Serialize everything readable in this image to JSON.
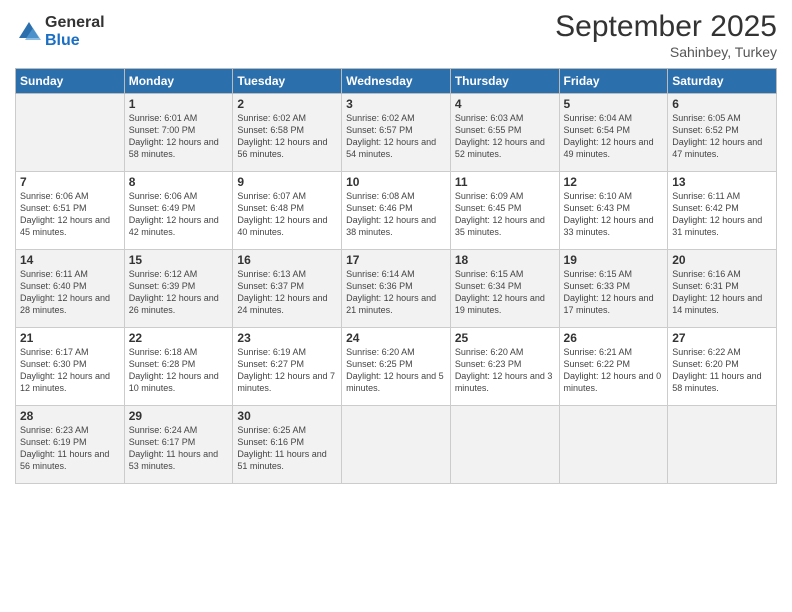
{
  "logo": {
    "general": "General",
    "blue": "Blue"
  },
  "title": "September 2025",
  "subtitle": "Sahinbey, Turkey",
  "weekdays": [
    "Sunday",
    "Monday",
    "Tuesday",
    "Wednesday",
    "Thursday",
    "Friday",
    "Saturday"
  ],
  "weeks": [
    [
      {
        "day": "",
        "sunrise": "",
        "sunset": "",
        "daylight": ""
      },
      {
        "day": "1",
        "sunrise": "Sunrise: 6:01 AM",
        "sunset": "Sunset: 7:00 PM",
        "daylight": "Daylight: 12 hours and 58 minutes."
      },
      {
        "day": "2",
        "sunrise": "Sunrise: 6:02 AM",
        "sunset": "Sunset: 6:58 PM",
        "daylight": "Daylight: 12 hours and 56 minutes."
      },
      {
        "day": "3",
        "sunrise": "Sunrise: 6:02 AM",
        "sunset": "Sunset: 6:57 PM",
        "daylight": "Daylight: 12 hours and 54 minutes."
      },
      {
        "day": "4",
        "sunrise": "Sunrise: 6:03 AM",
        "sunset": "Sunset: 6:55 PM",
        "daylight": "Daylight: 12 hours and 52 minutes."
      },
      {
        "day": "5",
        "sunrise": "Sunrise: 6:04 AM",
        "sunset": "Sunset: 6:54 PM",
        "daylight": "Daylight: 12 hours and 49 minutes."
      },
      {
        "day": "6",
        "sunrise": "Sunrise: 6:05 AM",
        "sunset": "Sunset: 6:52 PM",
        "daylight": "Daylight: 12 hours and 47 minutes."
      }
    ],
    [
      {
        "day": "7",
        "sunrise": "Sunrise: 6:06 AM",
        "sunset": "Sunset: 6:51 PM",
        "daylight": "Daylight: 12 hours and 45 minutes."
      },
      {
        "day": "8",
        "sunrise": "Sunrise: 6:06 AM",
        "sunset": "Sunset: 6:49 PM",
        "daylight": "Daylight: 12 hours and 42 minutes."
      },
      {
        "day": "9",
        "sunrise": "Sunrise: 6:07 AM",
        "sunset": "Sunset: 6:48 PM",
        "daylight": "Daylight: 12 hours and 40 minutes."
      },
      {
        "day": "10",
        "sunrise": "Sunrise: 6:08 AM",
        "sunset": "Sunset: 6:46 PM",
        "daylight": "Daylight: 12 hours and 38 minutes."
      },
      {
        "day": "11",
        "sunrise": "Sunrise: 6:09 AM",
        "sunset": "Sunset: 6:45 PM",
        "daylight": "Daylight: 12 hours and 35 minutes."
      },
      {
        "day": "12",
        "sunrise": "Sunrise: 6:10 AM",
        "sunset": "Sunset: 6:43 PM",
        "daylight": "Daylight: 12 hours and 33 minutes."
      },
      {
        "day": "13",
        "sunrise": "Sunrise: 6:11 AM",
        "sunset": "Sunset: 6:42 PM",
        "daylight": "Daylight: 12 hours and 31 minutes."
      }
    ],
    [
      {
        "day": "14",
        "sunrise": "Sunrise: 6:11 AM",
        "sunset": "Sunset: 6:40 PM",
        "daylight": "Daylight: 12 hours and 28 minutes."
      },
      {
        "day": "15",
        "sunrise": "Sunrise: 6:12 AM",
        "sunset": "Sunset: 6:39 PM",
        "daylight": "Daylight: 12 hours and 26 minutes."
      },
      {
        "day": "16",
        "sunrise": "Sunrise: 6:13 AM",
        "sunset": "Sunset: 6:37 PM",
        "daylight": "Daylight: 12 hours and 24 minutes."
      },
      {
        "day": "17",
        "sunrise": "Sunrise: 6:14 AM",
        "sunset": "Sunset: 6:36 PM",
        "daylight": "Daylight: 12 hours and 21 minutes."
      },
      {
        "day": "18",
        "sunrise": "Sunrise: 6:15 AM",
        "sunset": "Sunset: 6:34 PM",
        "daylight": "Daylight: 12 hours and 19 minutes."
      },
      {
        "day": "19",
        "sunrise": "Sunrise: 6:15 AM",
        "sunset": "Sunset: 6:33 PM",
        "daylight": "Daylight: 12 hours and 17 minutes."
      },
      {
        "day": "20",
        "sunrise": "Sunrise: 6:16 AM",
        "sunset": "Sunset: 6:31 PM",
        "daylight": "Daylight: 12 hours and 14 minutes."
      }
    ],
    [
      {
        "day": "21",
        "sunrise": "Sunrise: 6:17 AM",
        "sunset": "Sunset: 6:30 PM",
        "daylight": "Daylight: 12 hours and 12 minutes."
      },
      {
        "day": "22",
        "sunrise": "Sunrise: 6:18 AM",
        "sunset": "Sunset: 6:28 PM",
        "daylight": "Daylight: 12 hours and 10 minutes."
      },
      {
        "day": "23",
        "sunrise": "Sunrise: 6:19 AM",
        "sunset": "Sunset: 6:27 PM",
        "daylight": "Daylight: 12 hours and 7 minutes."
      },
      {
        "day": "24",
        "sunrise": "Sunrise: 6:20 AM",
        "sunset": "Sunset: 6:25 PM",
        "daylight": "Daylight: 12 hours and 5 minutes."
      },
      {
        "day": "25",
        "sunrise": "Sunrise: 6:20 AM",
        "sunset": "Sunset: 6:23 PM",
        "daylight": "Daylight: 12 hours and 3 minutes."
      },
      {
        "day": "26",
        "sunrise": "Sunrise: 6:21 AM",
        "sunset": "Sunset: 6:22 PM",
        "daylight": "Daylight: 12 hours and 0 minutes."
      },
      {
        "day": "27",
        "sunrise": "Sunrise: 6:22 AM",
        "sunset": "Sunset: 6:20 PM",
        "daylight": "Daylight: 11 hours and 58 minutes."
      }
    ],
    [
      {
        "day": "28",
        "sunrise": "Sunrise: 6:23 AM",
        "sunset": "Sunset: 6:19 PM",
        "daylight": "Daylight: 11 hours and 56 minutes."
      },
      {
        "day": "29",
        "sunrise": "Sunrise: 6:24 AM",
        "sunset": "Sunset: 6:17 PM",
        "daylight": "Daylight: 11 hours and 53 minutes."
      },
      {
        "day": "30",
        "sunrise": "Sunrise: 6:25 AM",
        "sunset": "Sunset: 6:16 PM",
        "daylight": "Daylight: 11 hours and 51 minutes."
      },
      {
        "day": "",
        "sunrise": "",
        "sunset": "",
        "daylight": ""
      },
      {
        "day": "",
        "sunrise": "",
        "sunset": "",
        "daylight": ""
      },
      {
        "day": "",
        "sunrise": "",
        "sunset": "",
        "daylight": ""
      },
      {
        "day": "",
        "sunrise": "",
        "sunset": "",
        "daylight": ""
      }
    ]
  ]
}
